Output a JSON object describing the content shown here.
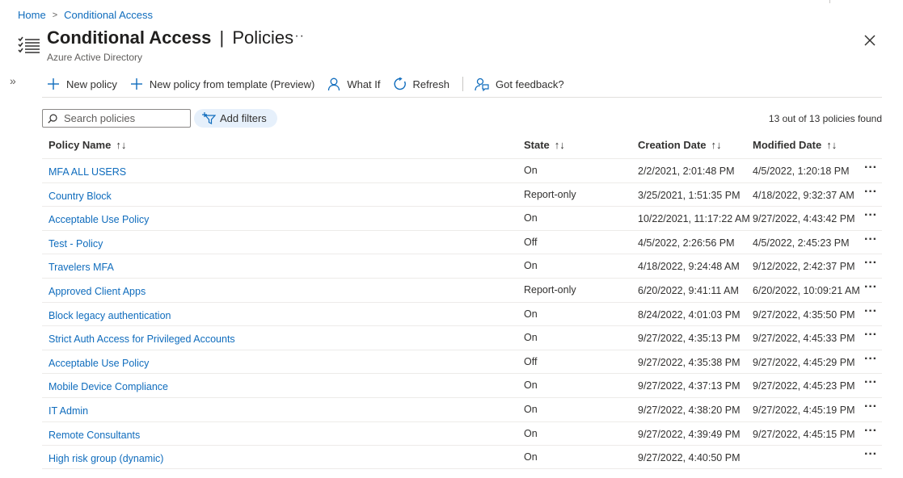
{
  "breadcrumb": {
    "home": "Home",
    "current": "Conditional Access",
    "separator": ">"
  },
  "header": {
    "title_main": "Conditional Access",
    "title_separator": "|",
    "title_sub": "Policies",
    "subtitle": "Azure Active Directory",
    "more": "···"
  },
  "toolbar": {
    "new_policy": "New policy",
    "new_from_template": "New policy from template (Preview)",
    "what_if": "What If",
    "refresh": "Refresh",
    "feedback": "Got feedback?"
  },
  "search": {
    "placeholder": "Search policies"
  },
  "filters": {
    "add_label": "Add filters"
  },
  "result_count": "13 out of 13 policies found",
  "columns": {
    "name": "Policy Name",
    "state": "State",
    "created": "Creation Date",
    "modified": "Modified Date",
    "sort_glyph": "↑↓"
  },
  "collapse_glyph": "»",
  "row_more_glyph": "···",
  "policies": [
    {
      "name": "MFA ALL USERS",
      "state": "On",
      "created": "2/2/2021, 2:01:48 PM",
      "modified": "4/5/2022, 1:20:18 PM"
    },
    {
      "name": "Country Block",
      "state": "Report-only",
      "created": "3/25/2021, 1:51:35 PM",
      "modified": "4/18/2022, 9:32:37 AM"
    },
    {
      "name": "Acceptable Use Policy",
      "state": "On",
      "created": "10/22/2021, 11:17:22 AM",
      "modified": "9/27/2022, 4:43:42 PM"
    },
    {
      "name": "Test - Policy",
      "state": "Off",
      "created": "4/5/2022, 2:26:56 PM",
      "modified": "4/5/2022, 2:45:23 PM"
    },
    {
      "name": "Travelers MFA",
      "state": "On",
      "created": "4/18/2022, 9:24:48 AM",
      "modified": "9/12/2022, 2:42:37 PM"
    },
    {
      "name": "Approved Client Apps",
      "state": "Report-only",
      "created": "6/20/2022, 9:41:11 AM",
      "modified": "6/20/2022, 10:09:21 AM"
    },
    {
      "name": "Block legacy authentication",
      "state": "On",
      "created": "8/24/2022, 4:01:03 PM",
      "modified": "9/27/2022, 4:35:50 PM"
    },
    {
      "name": "Strict Auth Access for Privileged Accounts",
      "state": "On",
      "created": "9/27/2022, 4:35:13 PM",
      "modified": "9/27/2022, 4:45:33 PM"
    },
    {
      "name": "Acceptable Use Policy",
      "state": "Off",
      "created": "9/27/2022, 4:35:38 PM",
      "modified": "9/27/2022, 4:45:29 PM"
    },
    {
      "name": "Mobile Device Compliance",
      "state": "On",
      "created": "9/27/2022, 4:37:13 PM",
      "modified": "9/27/2022, 4:45:23 PM"
    },
    {
      "name": "IT Admin",
      "state": "On",
      "created": "9/27/2022, 4:38:20 PM",
      "modified": "9/27/2022, 4:45:19 PM"
    },
    {
      "name": "Remote Consultants",
      "state": "On",
      "created": "9/27/2022, 4:39:49 PM",
      "modified": "9/27/2022, 4:45:15 PM"
    },
    {
      "name": "High risk group (dynamic)",
      "state": "On",
      "created": "9/27/2022, 4:40:50 PM",
      "modified": ""
    }
  ]
}
